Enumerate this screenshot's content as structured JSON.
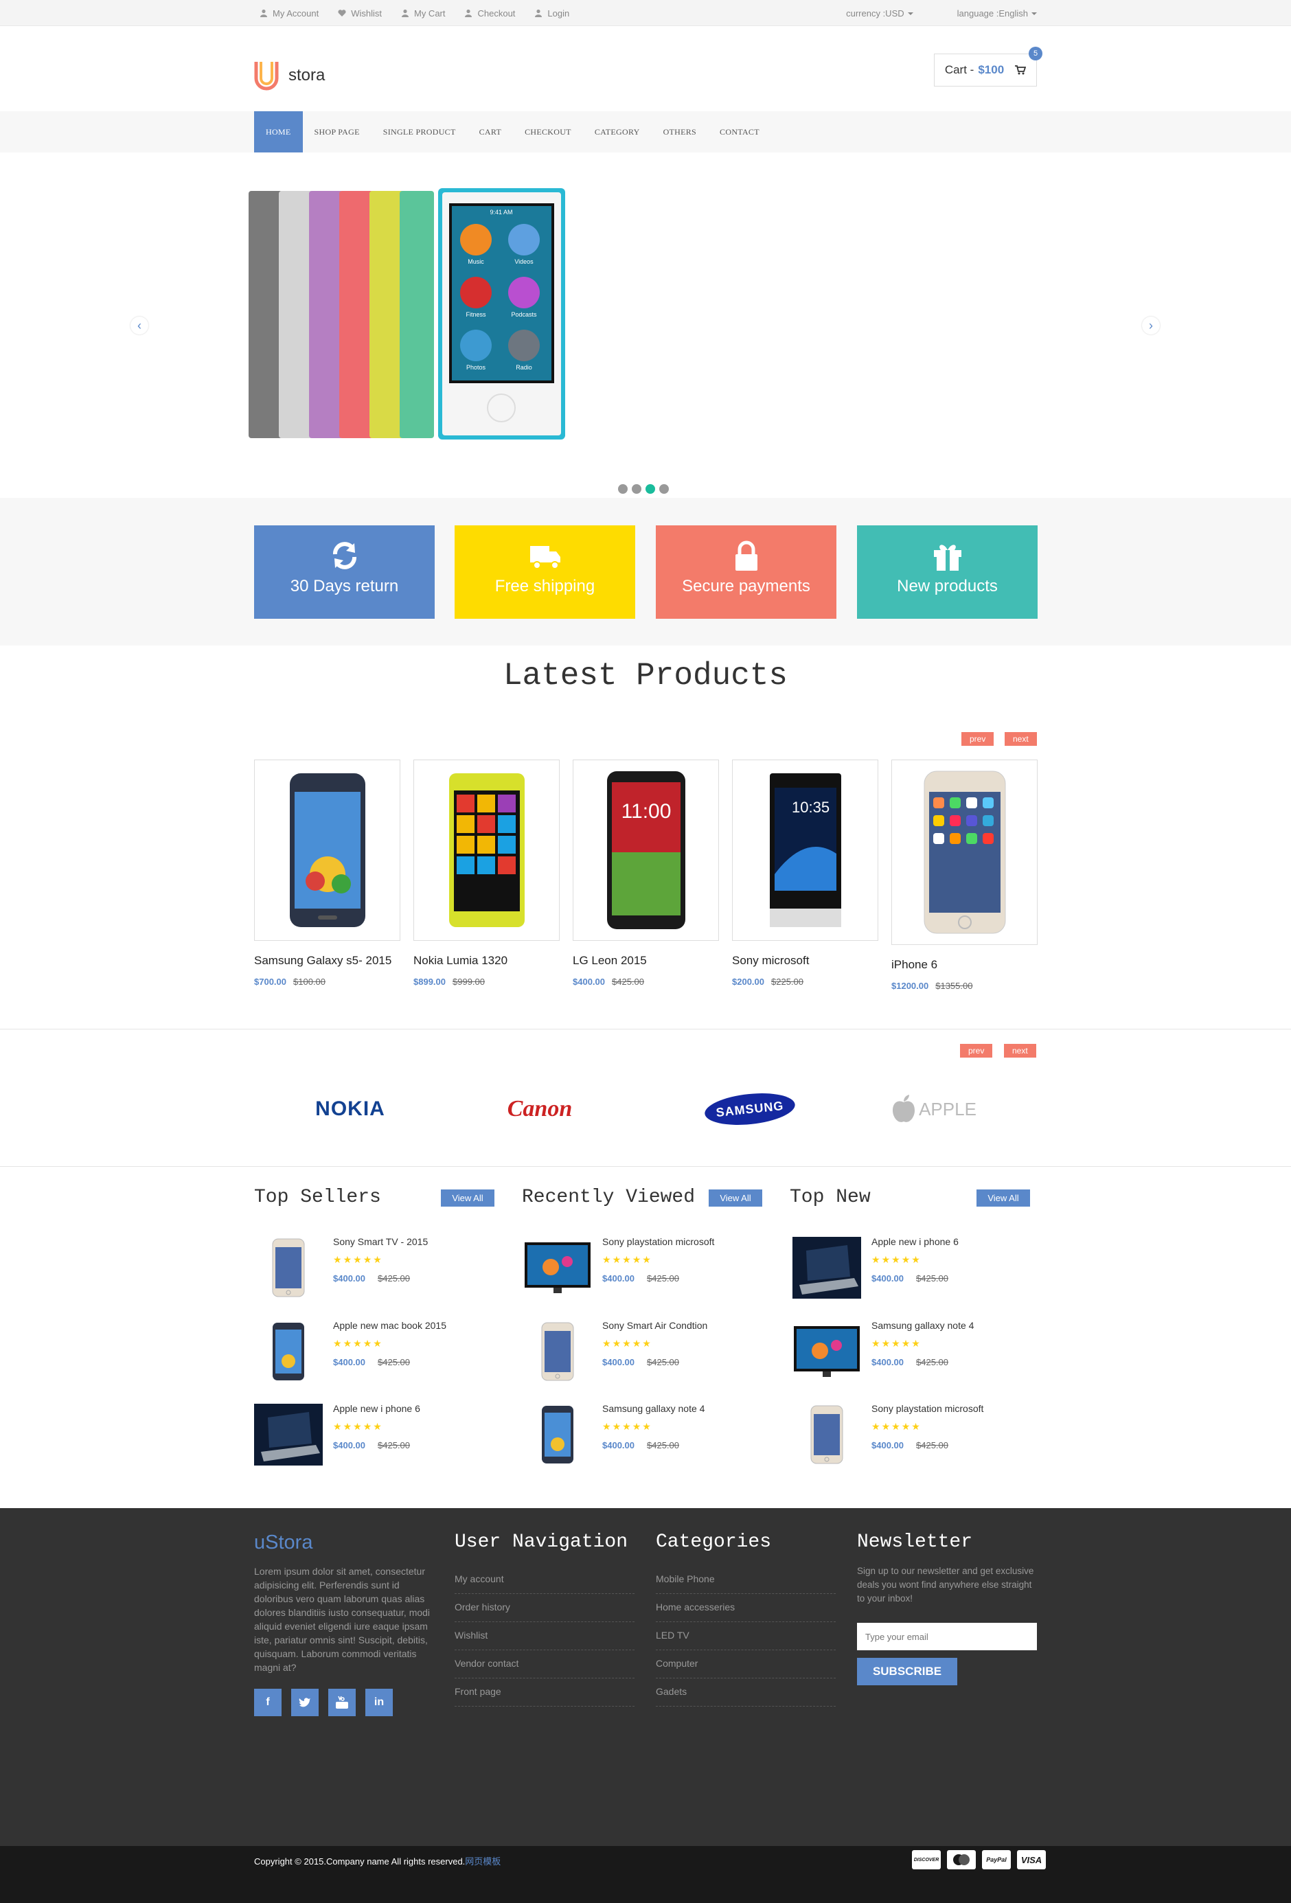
{
  "topbar": {
    "links": [
      "My Account",
      "Wishlist",
      "My Cart",
      "Checkout",
      "Login"
    ],
    "currency": "currency :USD",
    "language": "language :English"
  },
  "header": {
    "logo_text": "stora",
    "cart_label": "Cart -",
    "cart_amount": "$100",
    "cart_count": "5"
  },
  "nav": {
    "items": [
      "HOME",
      "SHOP PAGE",
      "SINGLE PRODUCT",
      "CART",
      "CHECKOUT",
      "CATEGORY",
      "OTHERS",
      "CONTACT"
    ],
    "active": "HOME"
  },
  "slider": {
    "prev_icon": "chevron-left-icon",
    "next_icon": "chevron-right-icon",
    "slide_count": 4,
    "active_index": 2,
    "app_labels": [
      "Music",
      "Videos",
      "Fitness",
      "Podcasts",
      "Photos",
      "Radio"
    ],
    "clock": "9:41 AM"
  },
  "promos": [
    {
      "label": "30 Days return",
      "icon": "refresh-icon",
      "color": "#5a88ca"
    },
    {
      "label": "Free shipping",
      "icon": "truck-icon",
      "color": "#fedc00"
    },
    {
      "label": "Secure payments",
      "icon": "lock-icon",
      "color": "#f37b6a"
    },
    {
      "label": "New products",
      "icon": "gift-icon",
      "color": "#42bdb4"
    }
  ],
  "latest": {
    "title": "Latest Products",
    "prev": "prev",
    "next": "next",
    "products": [
      {
        "name": "Samsung Galaxy s5- 2015",
        "price": "$700.00",
        "old_price": "$100.00"
      },
      {
        "name": "Nokia Lumia 1320",
        "price": "$899.00",
        "old_price": "$999.00"
      },
      {
        "name": "LG Leon 2015",
        "price": "$400.00",
        "old_price": "$425.00"
      },
      {
        "name": "Sony microsoft",
        "price": "$200.00",
        "old_price": "$225.00"
      },
      {
        "name": "iPhone 6",
        "price": "$1200.00",
        "old_price": "$1355.00"
      }
    ]
  },
  "brands": {
    "prev": "prev",
    "next": "next",
    "logos": [
      "NOKIA",
      "Canon",
      "SAMSUNG",
      "APPLE"
    ]
  },
  "widgets": [
    {
      "title": "Top Sellers",
      "view_all": "View All",
      "items": [
        {
          "name": "Sony Smart TV - 2015",
          "price": "$400.00",
          "old_price": "$425.00",
          "thumb": "iphone"
        },
        {
          "name": "Apple new mac book 2015",
          "price": "$400.00",
          "old_price": "$425.00",
          "thumb": "galaxy"
        },
        {
          "name": "Apple new i phone 6",
          "price": "$400.00",
          "old_price": "$425.00",
          "thumb": "laptop"
        }
      ]
    },
    {
      "title": "Recently Viewed",
      "view_all": "View All",
      "items": [
        {
          "name": "Sony playstation microsoft",
          "price": "$400.00",
          "old_price": "$425.00",
          "thumb": "tv"
        },
        {
          "name": "Sony Smart Air Condtion",
          "price": "$400.00",
          "old_price": "$425.00",
          "thumb": "iphone"
        },
        {
          "name": "Samsung gallaxy note 4",
          "price": "$400.00",
          "old_price": "$425.00",
          "thumb": "galaxy"
        }
      ]
    },
    {
      "title": "Top New",
      "view_all": "View All",
      "items": [
        {
          "name": "Apple new i phone 6",
          "price": "$400.00",
          "old_price": "$425.00",
          "thumb": "laptop"
        },
        {
          "name": "Samsung gallaxy note 4",
          "price": "$400.00",
          "old_price": "$425.00",
          "thumb": "tv"
        },
        {
          "name": "Sony playstation microsoft",
          "price": "$400.00",
          "old_price": "$425.00",
          "thumb": "iphone"
        }
      ]
    }
  ],
  "footer": {
    "brand": "uStora",
    "about": "Lorem ipsum dolor sit amet, consectetur adipisicing elit. Perferendis sunt id doloribus vero quam laborum quas alias dolores blanditiis iusto consequatur, modi aliquid eveniet eligendi iure eaque ipsam iste, pariatur omnis sint! Suscipit, debitis, quisquam. Laborum commodi veritatis magni at?",
    "social": [
      "f",
      "t",
      "yt",
      "in"
    ],
    "user_nav": {
      "title": "User Navigation",
      "items": [
        "My account",
        "Order history",
        "Wishlist",
        "Vendor contact",
        "Front page"
      ]
    },
    "categories": {
      "title": "Categories",
      "items": [
        "Mobile Phone",
        "Home accesseries",
        "LED TV",
        "Computer",
        "Gadets"
      ]
    },
    "newsletter": {
      "title": "Newsletter",
      "text": "Sign up to our newsletter and get exclusive deals you wont find anywhere else straight to your inbox!",
      "placeholder": "Type your email",
      "button": "SUBSCRIBE"
    },
    "copyright": "Copyright © 2015.Company name All rights reserved.",
    "copyright_link": "网页模板",
    "cards": [
      "DISCOVER",
      "MasterCard",
      "PayPal",
      "VISA"
    ]
  }
}
